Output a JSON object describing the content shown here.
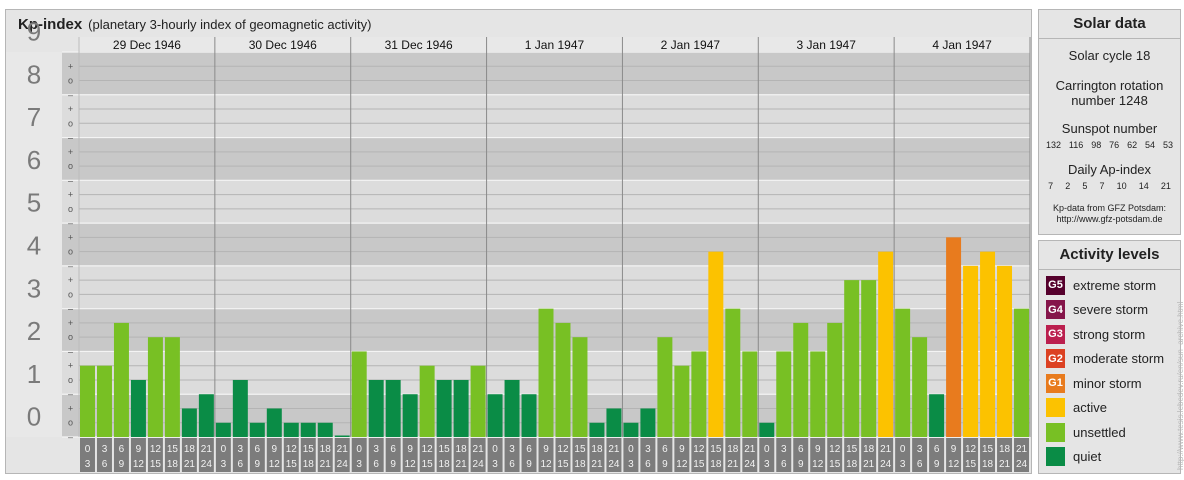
{
  "header": {
    "title": "Kp-index",
    "subtitle": "(planetary 3-hourly index of geomagnetic activity)"
  },
  "colors": {
    "quiet": "#0a8c46",
    "unsettled": "#78c024",
    "active": "#fcc200",
    "g1": "#e87b1e",
    "g2": "#dc4122",
    "g3": "#bb1f4e",
    "g4": "#85154a",
    "g5": "#55002c"
  },
  "chart_data": {
    "type": "bar",
    "ylim": [
      0,
      9
    ],
    "y_ticks": [
      "0",
      "1",
      "2",
      "3",
      "4",
      "5",
      "6",
      "7",
      "8",
      "9"
    ],
    "minor_tick_labels": [
      "–",
      "o",
      "+"
    ],
    "days": [
      "29 Dec 1946",
      "30 Dec 1946",
      "31 Dec 1946",
      "1 Jan 1947",
      "2 Jan 1947",
      "3 Jan 1947",
      "4 Jan 1947"
    ],
    "hour_labels": [
      [
        "0",
        "3"
      ],
      [
        "3",
        "6"
      ],
      [
        "6",
        "9"
      ],
      [
        "9",
        "12"
      ],
      [
        "12",
        "15"
      ],
      [
        "15",
        "18"
      ],
      [
        "18",
        "21"
      ],
      [
        "21",
        "24"
      ]
    ],
    "values": [
      [
        1.667,
        1.667,
        2.667,
        1.333,
        2.333,
        2.333,
        0.667,
        1.0
      ],
      [
        0.333,
        1.333,
        0.333,
        0.667,
        0.333,
        0.333,
        0.333,
        0.0
      ],
      [
        2.0,
        1.333,
        1.333,
        1.0,
        1.667,
        1.333,
        1.333,
        1.667
      ],
      [
        1.0,
        1.333,
        1.0,
        3.0,
        2.667,
        2.333,
        0.333,
        0.667
      ],
      [
        0.333,
        0.667,
        2.333,
        1.667,
        2.0,
        4.333,
        3.0,
        2.0
      ],
      [
        0.333,
        2.0,
        2.667,
        2.0,
        2.667,
        3.667,
        3.667,
        4.333
      ],
      [
        3.0,
        2.333,
        1.0,
        4.667,
        4.0,
        4.333,
        4.0,
        3.0
      ]
    ]
  },
  "solar": {
    "title": "Solar data",
    "cycle": "Solar cycle 18",
    "carrington_line1": "Carrington rotation",
    "carrington_line2": "number 1248",
    "sunspot_title": "Sunspot number",
    "sunspot_values": [
      "132",
      "116",
      "98",
      "76",
      "62",
      "54",
      "53"
    ],
    "ap_title": "Daily Ap-index",
    "ap_values": [
      "7",
      "2",
      "5",
      "7",
      "10",
      "14",
      "21"
    ],
    "credit_line1": "Kp-data from GFZ Potsdam:",
    "credit_line2": "http://www.gfz-potsdam.de"
  },
  "levels": {
    "title": "Activity levels",
    "items": [
      {
        "badge": "G5",
        "label": "extreme storm",
        "color": "#55002c"
      },
      {
        "badge": "G4",
        "label": "severe storm",
        "color": "#85154a"
      },
      {
        "badge": "G3",
        "label": "strong storm",
        "color": "#bb1f4e"
      },
      {
        "badge": "G2",
        "label": "moderate storm",
        "color": "#dc4122"
      },
      {
        "badge": "G1",
        "label": "minor storm",
        "color": "#e87b1e"
      },
      {
        "badge": "",
        "label": "active",
        "color": "#fcc200"
      },
      {
        "badge": "",
        "label": "unsettled",
        "color": "#78c024"
      },
      {
        "badge": "",
        "label": "quiet",
        "color": "#0a8c46"
      }
    ]
  },
  "watermark": "http://www.tesis.lebedev.ru/en/sun_archive.html"
}
